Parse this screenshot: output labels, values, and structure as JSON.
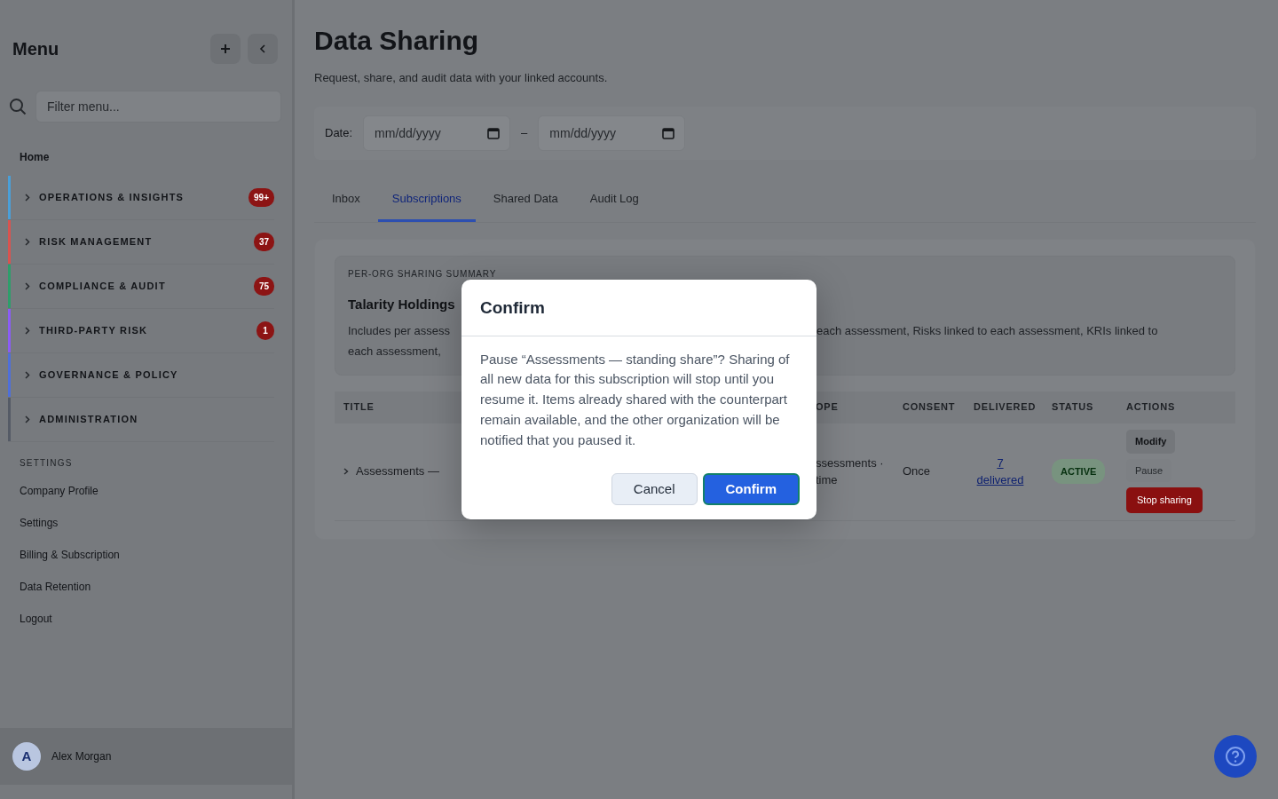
{
  "sidebar": {
    "title": "Menu",
    "filter": {
      "placeholder": "Filter menu..."
    },
    "home": "Home",
    "groups": [
      {
        "label": "OPERATIONS & INSIGHTS",
        "badge": "99+",
        "color": "#4a9fd8"
      },
      {
        "label": "RISK MANAGEMENT",
        "badge": "37",
        "color": "#d9534f"
      },
      {
        "label": "COMPLIANCE & AUDIT",
        "badge": "75",
        "color": "#2e9e6b"
      },
      {
        "label": "THIRD-PARTY RISK",
        "badge": "1",
        "color": "#8b5cf6"
      },
      {
        "label": "GOVERNANCE & POLICY",
        "color": "#4f6fd9"
      },
      {
        "label": "ADMINISTRATION",
        "color": "#555b66"
      }
    ],
    "settings_heading": "SETTINGS",
    "links": [
      "Company Profile",
      "Settings",
      "Billing & Subscription",
      "Data Retention",
      "Logout"
    ],
    "user": {
      "name": "Alex Morgan",
      "initial": "A"
    }
  },
  "page": {
    "title": "Data Sharing",
    "subtitle": "Request, share, and audit data with your linked accounts.",
    "date_filter": {
      "label": "Date:",
      "from_placeholder": "mm/dd/yyyy",
      "separator": "–",
      "to_placeholder": "mm/dd/yyyy"
    },
    "tabs": [
      {
        "label": "Inbox",
        "selected": false
      },
      {
        "label": "Subscriptions",
        "selected": true
      },
      {
        "label": "Shared Data",
        "selected": false
      },
      {
        "label": "Audit Log",
        "selected": false
      }
    ],
    "summary": {
      "heading": "PER-ORG SHARING SUMMARY",
      "org": "Talarity Holdings",
      "line_1_left": "Includes per assess",
      "line_1_right": "each assessment, Risks linked to each assessment, KRIs linked to",
      "line_2_left": "each assessment,"
    },
    "table": {
      "columns": [
        "TITLE",
        "",
        "OPE",
        "CONSENT",
        "DELIVERED",
        "STATUS",
        "ACTIONS"
      ],
      "rows": [
        {
          "expanded": false,
          "title": "Assessments —",
          "scope": [
            "ssessments ·",
            "time"
          ],
          "consent": "Once",
          "delivered": "7 delivered",
          "status": "ACTIVE",
          "actions": [
            {
              "label": "Modify",
              "kind": "secondary"
            },
            {
              "label": "Pause",
              "kind": "plain"
            },
            {
              "label": "Stop sharing",
              "kind": "danger"
            }
          ]
        }
      ]
    }
  },
  "dialog": {
    "title": "Confirm",
    "message": "Pause “Assessments — standing share”? Sharing of all new data for this subscription will stop until you resume it. Items already shared with the counterpart remain available, and the other organization will be notified that you paused it.",
    "buttons": [
      {
        "label": "Cancel",
        "kind": "secondary"
      },
      {
        "label": "Confirm",
        "kind": "primary"
      }
    ]
  }
}
